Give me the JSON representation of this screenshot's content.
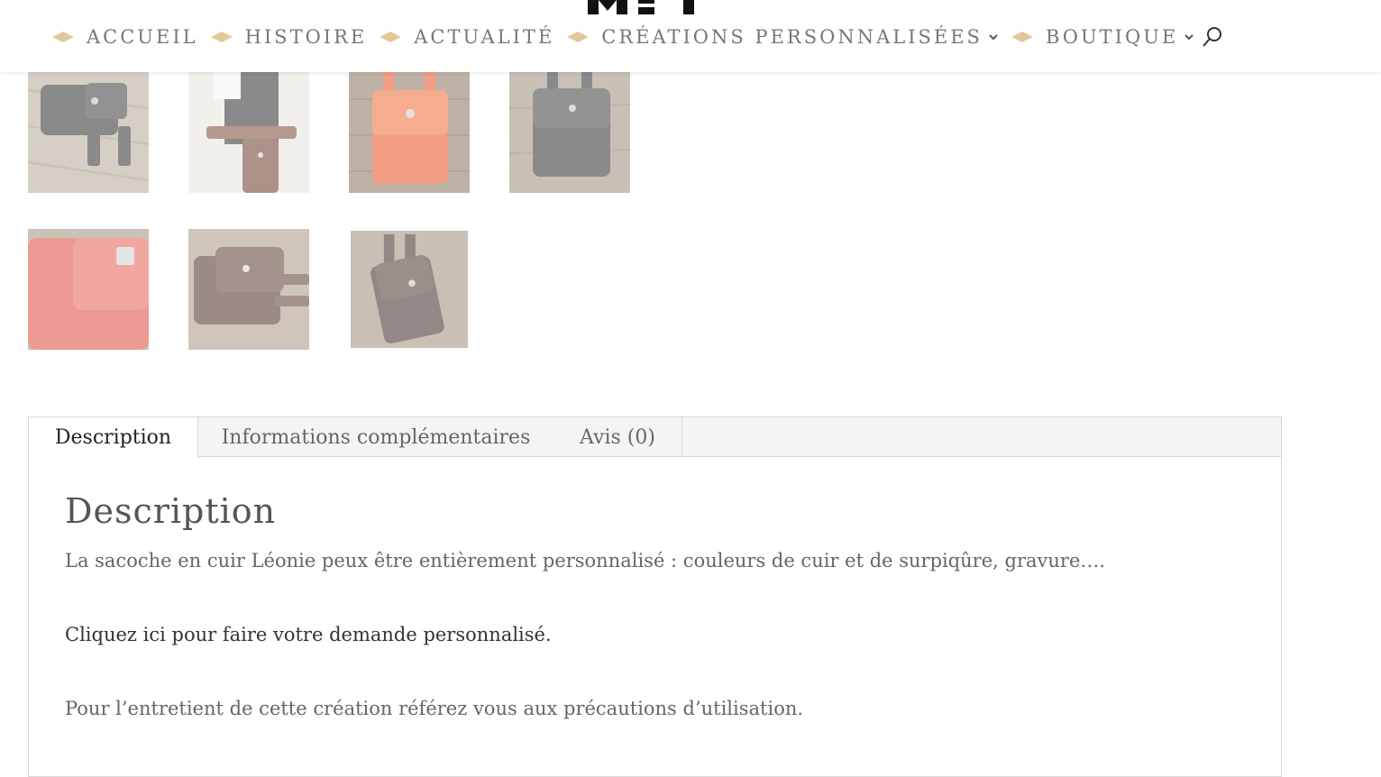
{
  "nav": {
    "items": [
      {
        "label": "ACCUEIL",
        "has_submenu": false
      },
      {
        "label": "HISTOIRE",
        "has_submenu": false
      },
      {
        "label": "ACTUALITÉ",
        "has_submenu": false
      },
      {
        "label": "CRÉATIONS PERSONNALISÉES",
        "has_submenu": true
      },
      {
        "label": "BOUTIQUE",
        "has_submenu": true
      }
    ],
    "diamond_color": "#e3c99a",
    "search_icon": "search-icon"
  },
  "gallery": {
    "images": [
      {
        "name": "product-thumb-1",
        "leather": "#2b2b2b"
      },
      {
        "name": "product-thumb-2",
        "leather": "#6b3a2a"
      },
      {
        "name": "product-thumb-3",
        "leather": "#e8501f"
      },
      {
        "name": "product-thumb-4",
        "leather": "#2c2c2c"
      },
      {
        "name": "product-thumb-5",
        "leather": "#e04a3a"
      },
      {
        "name": "product-thumb-6",
        "leather": "#4a2c24"
      },
      {
        "name": "product-thumb-7",
        "leather": "#3a2a26"
      }
    ]
  },
  "tabs": {
    "items": [
      {
        "label": "Description",
        "active": true
      },
      {
        "label": "Informations complémentaires",
        "active": false
      },
      {
        "label": "Avis (0)",
        "active": false
      }
    ]
  },
  "description": {
    "title": "Description",
    "paragraph_1": "La sacoche en cuir Léonie peux être entièrement personnalisé : couleurs de cuir et de surpiqûre, gravure….",
    "paragraph_2": "Cliquez ici pour faire votre demande personnalisé.",
    "paragraph_3": "Pour l’entretient de cette création référez vous aux précautions d’utilisation."
  },
  "colors": {
    "wood": "#8a7a6a",
    "text": "#666666",
    "border": "#d9d9d9"
  }
}
